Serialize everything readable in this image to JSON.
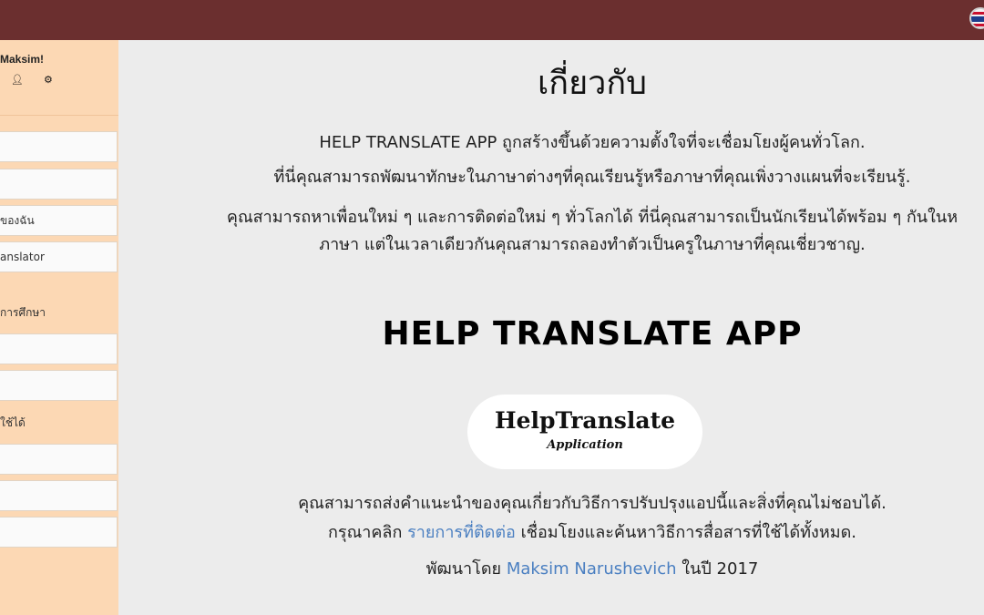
{
  "sidebar": {
    "greeting": "Maksim!",
    "icons": [
      "user-icon",
      "gear-icon"
    ],
    "items": [
      {
        "label": ""
      },
      {
        "label": ""
      },
      {
        "label": "ของฉัน"
      },
      {
        "label": "anslator"
      }
    ],
    "section_label_1": "การศึกษา",
    "items_2": [
      {
        "label": ""
      },
      {
        "label": ""
      }
    ],
    "section_label_2": "ใช้ได้",
    "items_3": [
      {
        "label": ""
      },
      {
        "label": ""
      },
      {
        "label": ""
      }
    ]
  },
  "main": {
    "title": "เกี่ยวกับ",
    "para1": "HELP TRANSLATE APP ถูกสร้างขึ้นด้วยความตั้งใจที่จะเชื่อมโยงผู้คนทั่วโลก.",
    "para2": "ที่นี่คุณสามารถพัฒนาทักษะในภาษาต่างๆที่คุณเรียนรู้หรือภาษาที่คุณเพิ่งวางแผนที่จะเรียนรู้.",
    "para3_line1": "คุณสามารถหาเพื่อนใหม่ ๆ และการติดต่อใหม่ ๆ ทั่วโลกได้ ที่นี่คุณสามารถเป็นนักเรียนได้พร้อม ๆ กันในห",
    "para3_line2": "ภาษา แต่ในเวลาเดียวกันคุณสามารถลองทำตัวเป็นครูในภาษาที่คุณเชี่ยวชาญ.",
    "brand_heading": "HELP TRANSLATE APP",
    "logo_main": "HelpTranslate",
    "logo_sub": "Application",
    "suggest_line": "คุณสามารถส่งคำแนะนำของคุณเกี่ยวกับวิธีการปรับปรุงแอปนี้และสิ่งที่คุณไม่ชอบได้.",
    "contact_prefix": "กรุณาคลิก",
    "contact_link": "รายการที่ติดต่อ",
    "contact_suffix": "เชื่อมโยงและค้นหาวิธีการสื่อสารที่ใช้ได้ทั้งหมด.",
    "dev_prefix": "พัฒนาโดย",
    "dev_link": "Maksim Narushevich",
    "dev_suffix": "ในปี 2017"
  }
}
